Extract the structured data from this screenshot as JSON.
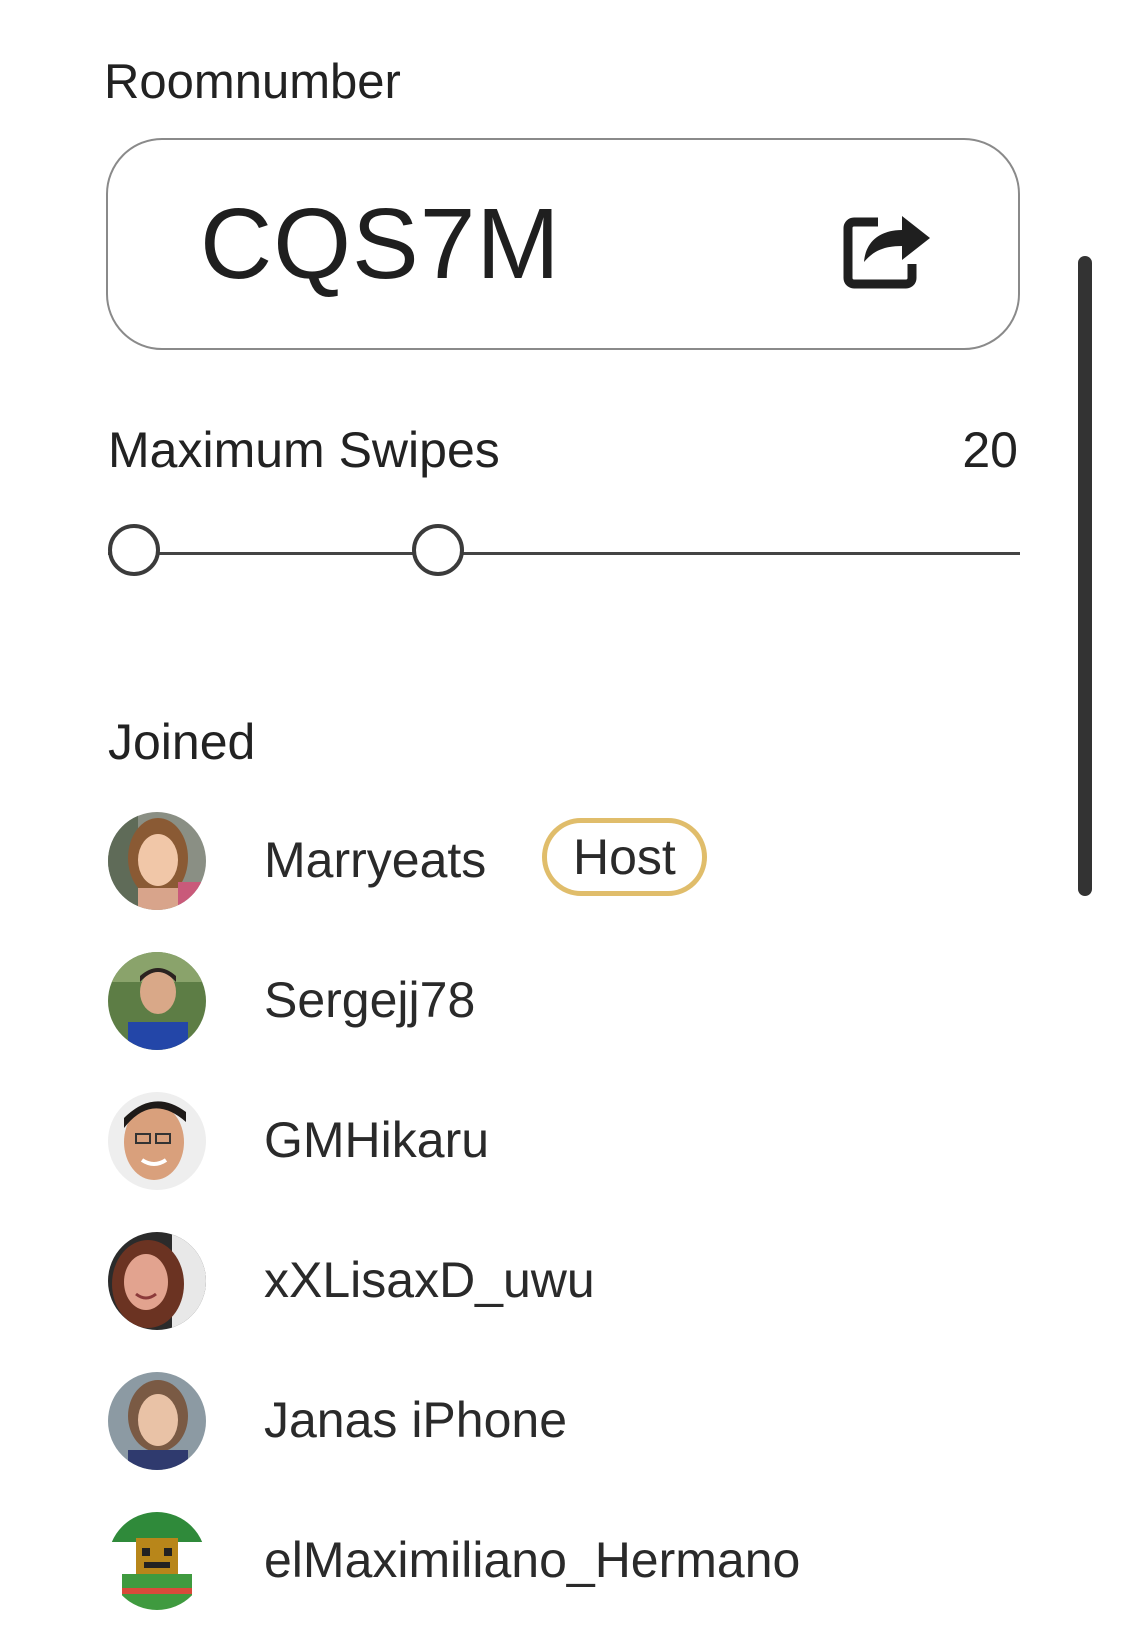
{
  "room": {
    "label": "Roomnumber",
    "code": "CQS7M",
    "share_icon": "share-icon"
  },
  "swipes": {
    "label": "Maximum Swipes",
    "value": "20",
    "slider_range_fraction": [
      0.0,
      0.34
    ]
  },
  "joined": {
    "label": "Joined",
    "members": [
      {
        "name": "Marryeats",
        "badge": "Host",
        "avatar": "avatar-photo"
      },
      {
        "name": "Sergejj78",
        "avatar": "avatar-photo"
      },
      {
        "name": "GMHikaru",
        "avatar": "avatar-photo"
      },
      {
        "name": "xXLisaxD_uwu",
        "avatar": "avatar-photo"
      },
      {
        "name": "Janas iPhone",
        "avatar": "avatar-photo"
      },
      {
        "name": "elMaximiliano_Hermano",
        "avatar": "avatar-photo"
      }
    ]
  },
  "colors": {
    "host_badge_border": "#e0bd6b",
    "text": "#222222",
    "scrollbar": "#333333"
  }
}
